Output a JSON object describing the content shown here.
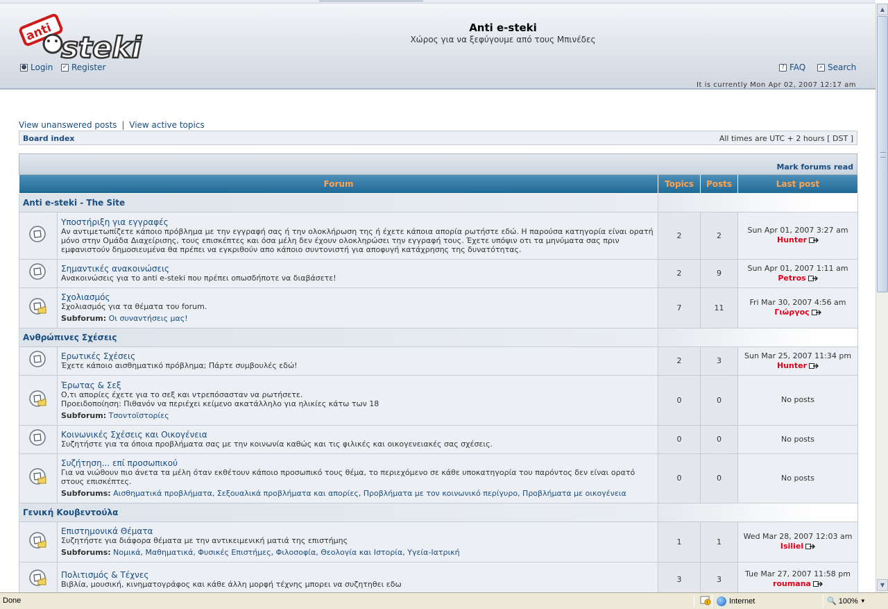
{
  "site": {
    "logo_text_anti": "anti",
    "logo_text_steki": "steki",
    "title": "Anti e-steki",
    "description": "Χώρος για να ξεφύγουμε από τους Μπινέδες"
  },
  "header_links": {
    "login": "Login",
    "register": "Register",
    "faq": "FAQ",
    "search": "Search"
  },
  "datetime": "It is currently Mon Apr 02, 2007 12:17 am",
  "nav": {
    "unanswered": "View unanswered posts",
    "separator": "|",
    "active": "View active topics",
    "board_index": "Board index",
    "timezone": "All times are UTC + 2 hours [ DST ]"
  },
  "table": {
    "mark_read": "Mark forums read",
    "col_forum": "Forum",
    "col_topics": "Topics",
    "col_posts": "Posts",
    "col_last": "Last post"
  },
  "categories": [
    {
      "name": "Anti e-steki - The Site",
      "forums": [
        {
          "title": "Υποστήριξη για εγγραφές",
          "desc": "Αν αντιμετωπίζετε κάποιο πρόβλημα με την εγγραφή σας ή την ολοκλήρωση της ή έχετε κάποια απορία ρωτήστε εδώ. Η παρούσα κατηγορία είναι ορατή μόνο στην Ομάδα Διαχείρισης, τους επισκέπτες και όσα μέλη δεν έχουν ολοκληρώσει την εγγραφή τους. Έχετε υπόψιν οτι τα μηνύματα σας πριν εμφανιστούν δημοσιευμένα θα πρέπει να εγκριθούν απο κάποιο συντονιστή για αποφυγή κατάχρησης της δυνατότητας.",
          "subforum_label": "",
          "subforums": "",
          "topics": "2",
          "posts": "2",
          "last_date": "Sun Apr 01, 2007 3:27 am",
          "last_author": "Hunter",
          "icon": "folder-icon"
        },
        {
          "title": "Σημαντικές ανακοινώσεις",
          "desc": "Ανακοινώσεις για το anti e-steki που πρέπει οπωσδήποτε να διαβάσετε!",
          "subforum_label": "",
          "subforums": "",
          "topics": "2",
          "posts": "9",
          "last_date": "Sun Apr 01, 2007 1:11 am",
          "last_author": "Petros",
          "icon": "folder-icon"
        },
        {
          "title": "Σχολιασμός",
          "desc": "Σχολιασμός για τα θέματα του forum.",
          "subforum_label": "Subforum:",
          "subforums": "Οι συναντήσεις μας!",
          "topics": "7",
          "posts": "11",
          "last_date": "Fri Mar 30, 2007 4:56 am",
          "last_author": "Γιώργος",
          "icon": "subforum-folder-icon"
        }
      ]
    },
    {
      "name": "Ανθρώπινες Σχέσεις",
      "forums": [
        {
          "title": "Ερωτικές Σχέσεις",
          "desc": "Έχετε κάποιο αισθηματικό πρόβλημα; Πάρτε συμβουλές εδώ!",
          "subforum_label": "",
          "subforums": "",
          "topics": "2",
          "posts": "3",
          "last_date": "Sun Mar 25, 2007 11:34 pm",
          "last_author": "Hunter",
          "icon": "folder-icon"
        },
        {
          "title": "Έρωτας & Σεξ",
          "desc": "Ο,τι απορίες έχετε για το σεξ και ντρεπόσασταν να ρωτήσετε.\nΠροειδοποίηση: Πιθανόν να περιέχει κείμενο ακατάλληλο για ηλικίες κάτω των 18",
          "subforum_label": "Subforum:",
          "subforums": "Τσοντοϊστορίες",
          "topics": "0",
          "posts": "0",
          "last_date": "",
          "last_author": "",
          "no_posts": "No posts",
          "icon": "subforum-folder-icon"
        },
        {
          "title": "Κοινωνικές Σχέσεις και Οικογένεια",
          "desc": "Συζητήστε για τα όποια προβλήματα σας με την κοινωνία καθώς και τις φιλικές και οικογενειακές σας σχέσεις.",
          "subforum_label": "",
          "subforums": "",
          "topics": "0",
          "posts": "0",
          "last_date": "",
          "last_author": "",
          "no_posts": "No posts",
          "icon": "folder-icon"
        },
        {
          "title": "Συζήτηση... επί προσωπικού",
          "desc": "Για να νιώθουν πιο άνετα τα μέλη όταν εκθέτουν κάποιο προσωπικό τους θέμα, το περιεχόμενο σε κάθε υποκατηγορία του παρόντος δεν είναι ορατό στους επισκέπτες.",
          "subforum_label": "Subforums:",
          "subforums": "Αισθηματικά προβλήματα, Σεξουαλικά προβλήματα και απορίες, Προβλήματα με τον κοινωνικό περίγυρο, Προβλήματα με οικογένεια",
          "topics": "0",
          "posts": "0",
          "last_date": "",
          "last_author": "",
          "no_posts": "No posts",
          "icon": "subforum-folder-icon"
        }
      ]
    },
    {
      "name": "Γενική Κουβεντούλα",
      "forums": [
        {
          "title": "Επιστημονικά Θέματα",
          "desc": "Συζητήστε για διάφορα θέματα με την αντικειμενική ματιά της επιστήμης",
          "subforum_label": "Subforums:",
          "subforums": "Νομικά, Μαθηματικά, Φυσικές Επιστήμες, Φιλοσοφία, Θεολογία και Ιστορία, Υγεία-Ιατρική",
          "topics": "1",
          "posts": "1",
          "last_date": "Wed Mar 28, 2007 12:03 am",
          "last_author": "Isiliel",
          "icon": "subforum-folder-icon"
        },
        {
          "title": "Πολιτισμός & Τέχνες",
          "desc": "Βιβλία, μουσική, κινηματογράφος και κάθε άλλη μορφή τέχνης μπορει να συζητηθει εδω",
          "subforum_label": "",
          "subforums": "",
          "topics": "3",
          "posts": "3",
          "last_date": "Tue Mar 27, 2007 11:58 pm",
          "last_author": "roumana",
          "icon": "subforum-folder-icon"
        }
      ]
    }
  ],
  "statusbar": {
    "status": "Done",
    "zone": "Internet",
    "zoom": "100%"
  }
}
